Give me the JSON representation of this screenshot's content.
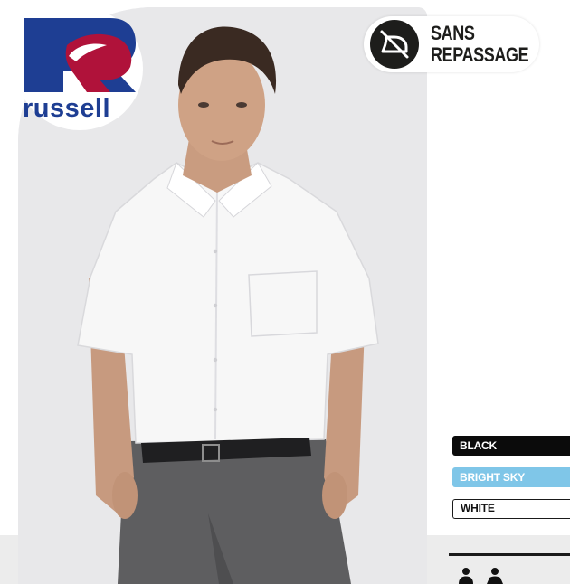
{
  "brand": {
    "name": "russell"
  },
  "badge": {
    "line1": "SANS",
    "line2": "REPASSAGE",
    "icon": "no-ironing-icon"
  },
  "colors": {
    "brand_blue": "#1e3e93",
    "brand_red": "#b0123a",
    "black_swatch": "#0b0b0b",
    "bright_sky_swatch": "#7fc6e8",
    "white_swatch": "#ffffff"
  },
  "swatches": [
    {
      "label": "BLACK",
      "color": "#0b0b0b"
    },
    {
      "label": "BRIGHT SKY",
      "color": "#7fc6e8"
    },
    {
      "label": "WHITE",
      "color": "#ffffff"
    }
  ],
  "fit_icons": [
    "men-fit-icon",
    "women-fit-icon"
  ]
}
